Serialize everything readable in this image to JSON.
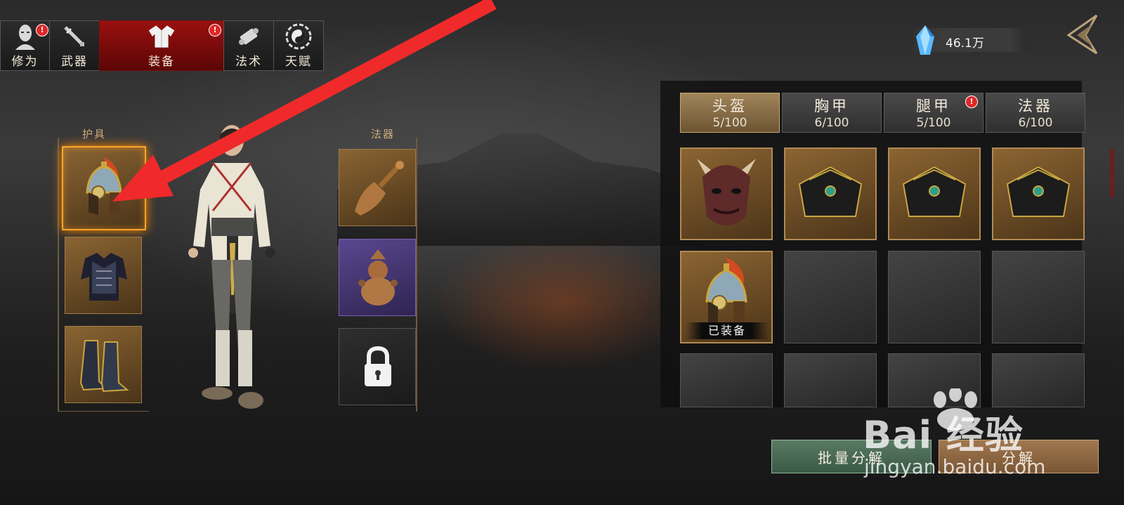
{
  "nav": {
    "tabs": [
      {
        "label": "修为",
        "icon": "head-icon",
        "badge": "!"
      },
      {
        "label": "武器",
        "icon": "sword-icon"
      },
      {
        "label": "装备",
        "icon": "robe-icon",
        "badge": "!",
        "active": true
      },
      {
        "label": "法术",
        "icon": "scroll-icon"
      },
      {
        "label": "天赋",
        "icon": "bagua-icon"
      }
    ]
  },
  "currency": {
    "icon": "crystal-icon",
    "value": "46.1万"
  },
  "equipment": {
    "armor_title": "护具",
    "magic_title": "法器",
    "armor_slots": [
      {
        "item": "helmet",
        "selected": true
      },
      {
        "item": "chest-armor"
      },
      {
        "item": "boots"
      }
    ],
    "magic_slots": [
      {
        "item": "bell"
      },
      {
        "item": "gourd"
      },
      {
        "item": "locked"
      }
    ]
  },
  "inventory": {
    "tabs": [
      {
        "label": "头盔",
        "count": "5/100",
        "active": true
      },
      {
        "label": "胸甲",
        "count": "6/100"
      },
      {
        "label": "腿甲",
        "count": "5/100",
        "badge": "!"
      },
      {
        "label": "法器",
        "count": "6/100"
      }
    ],
    "equipped_label": "已装备"
  },
  "buttons": {
    "batch": "批量分解",
    "decompose": "分解"
  },
  "watermark": {
    "main": "Bai 经验",
    "sub": "jingyan.baidu.com"
  },
  "colors": {
    "active_tab": "#8a0c0c",
    "highlight": "#ffa424",
    "item_bg": "#8b6432",
    "batch_btn": "#4a6a54"
  }
}
